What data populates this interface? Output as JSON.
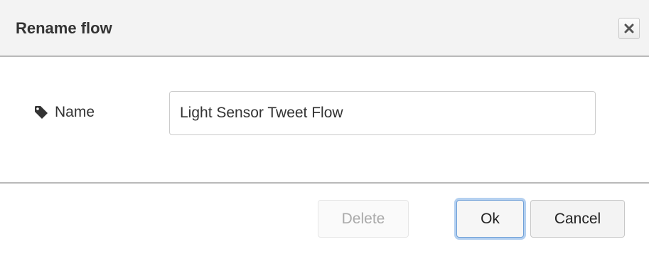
{
  "dialog": {
    "title": "Rename flow",
    "close_icon": "close-icon"
  },
  "form": {
    "name_label": "Name",
    "name_icon": "tag-icon",
    "name_value": "Light Sensor Tweet Flow"
  },
  "footer": {
    "delete_label": "Delete",
    "ok_label": "Ok",
    "cancel_label": "Cancel"
  }
}
